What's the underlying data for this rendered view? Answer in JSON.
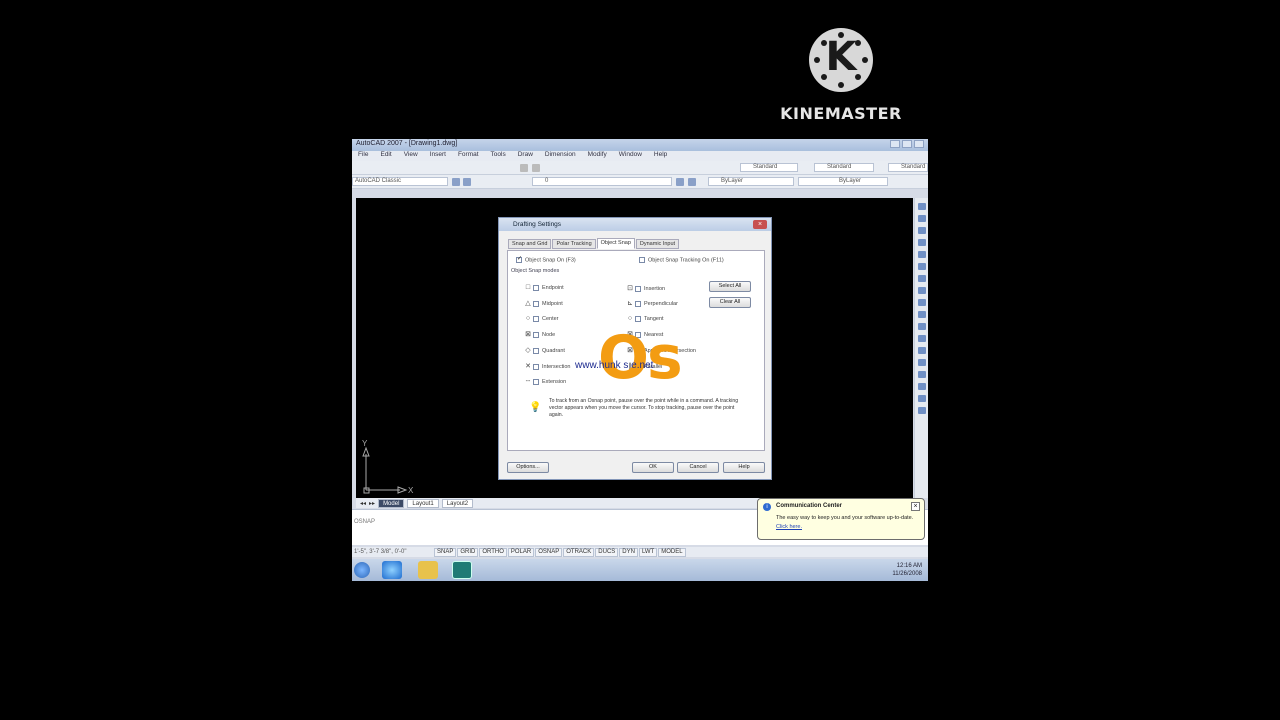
{
  "watermark": {
    "logo_letter": "K",
    "text": "KINEMASTER"
  },
  "window": {
    "title": "AutoCAD 2007 - [Drawing1.dwg]",
    "menu": [
      "File",
      "Edit",
      "View",
      "Insert",
      "Format",
      "Tools",
      "Draw",
      "Dimension",
      "Modify",
      "Window",
      "Help"
    ],
    "workspace": "AutoCAD Classic",
    "layer": "0",
    "text_style": "Standard",
    "dim_style": "Standard",
    "table_style": "Standard",
    "color": "ByLayer",
    "linetype": "ByLayer",
    "layout_tabs": [
      "Model",
      "Layout1",
      "Layout2"
    ],
    "command_text": "OSNAP",
    "coords": "1'-5\", 3'-7 3/8\", 0'-0\"",
    "status_buttons": [
      "SNAP",
      "GRID",
      "ORTHO",
      "POLAR",
      "OSNAP",
      "OTRACK",
      "DUCS",
      "DYN",
      "LWT",
      "MODEL"
    ],
    "ucs_axis_x": "X",
    "ucs_axis_y": "Y"
  },
  "dialog": {
    "title": "Drafting Settings",
    "tabs": [
      "Snap and Grid",
      "Polar Tracking",
      "Object Snap",
      "Dynamic Input"
    ],
    "active_tab": "Object Snap",
    "snap_on": "Object Snap On (F3)",
    "tracking_on": "Object Snap Tracking On (F11)",
    "group_label": "Object Snap modes",
    "left_modes": [
      "Endpoint",
      "Midpoint",
      "Center",
      "Node",
      "Quadrant",
      "Intersection",
      "Extension"
    ],
    "right_modes": [
      "Insertion",
      "Perpendicular",
      "Tangent",
      "Nearest",
      "Apparent intersection",
      "Parallel"
    ],
    "left_symbols": [
      "□",
      "△",
      "○",
      "⊠",
      "◇",
      "✕",
      "--"
    ],
    "right_symbols": [
      "⊡",
      "⊾",
      "○",
      "⊠",
      "⊠",
      "∥"
    ],
    "select_all": "Select All",
    "clear_all": "Clear All",
    "hint": "To track from an Osnap point, pause over the point while in a command.  A tracking vector appears when you move the cursor. To stop tracking, pause over the point again.",
    "options": "Options...",
    "ok": "OK",
    "cancel": "Cancel",
    "help": "Help"
  },
  "overlay": {
    "big_text": "Os",
    "url_text": "www.hunk    s  e.net"
  },
  "balloon": {
    "title": "Communication Center",
    "body": "The easy way to keep you and your software up-to-date.",
    "link": "Click here."
  },
  "taskbar": {
    "time": "12:16 AM",
    "date": "11/26/2008"
  },
  "colors": {
    "accent_orange": "#f39c12",
    "url_blue": "#1c2a8f"
  }
}
